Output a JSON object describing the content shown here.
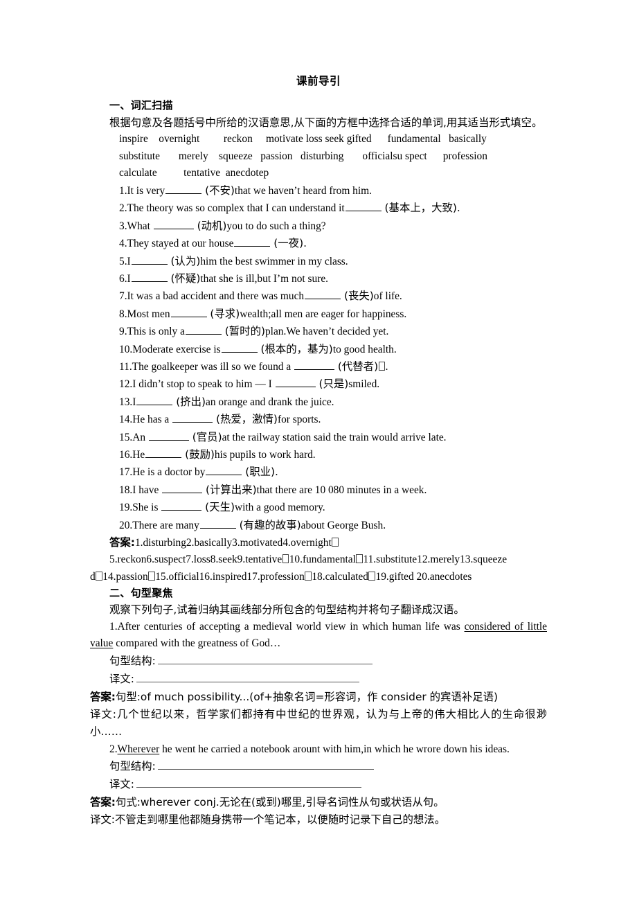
{
  "document": {
    "title": "课前导引"
  },
  "section1": {
    "heading": "一、词汇扫描",
    "instruction": "根据句意及各题括号中所给的汉语意思,从下面的方框中选择合适的单词,用其适当形式填空。",
    "word_bank_rows": [
      "inspire    overnight         reckon     motivate loss seek gifted      fundamental   basically",
      "substitute       merely    squeeze   passion   disturbing       officialsu spect      profession",
      "calculate          tentative  anecdotep"
    ],
    "word_bank_flat": [
      "inspire",
      "overnight",
      "reckon",
      "motivate",
      "loss",
      "seek",
      "gifted",
      "fundamental",
      "basically",
      "substitute",
      "merely",
      "squeeze",
      "passion",
      "disturbing",
      "officialsu spect",
      "profession",
      "calculate",
      "tentative",
      "anecdotep"
    ],
    "questions": [
      {
        "num": "1.",
        "pre": "It is very",
        "hint": "(不安)",
        "post": "that we haven’t heard from him.",
        "blank": "b-md",
        "gap_before": false
      },
      {
        "num": "2.",
        "pre": "The theory was so complex that I can understand it",
        "hint": "(基本上，大致).",
        "post": "",
        "blank": "b-md",
        "gap_before": false
      },
      {
        "num": "3.",
        "pre": "What",
        "hint": "(动机)",
        "post": "you to do such a thing?",
        "blank": "b-lg",
        "gap_before": true
      },
      {
        "num": "4.",
        "pre": "They stayed at our house",
        "hint": "(一夜).",
        "post": "",
        "blank": "b-md",
        "gap_before": false
      },
      {
        "num": "5.",
        "pre": "I",
        "hint": "(认为)",
        "post": "him the best swimmer in my class.",
        "blank": "b-md",
        "gap_before": false
      },
      {
        "num": "6.",
        "pre": "I",
        "hint": "(怀疑)",
        "post": "that she is ill,but I’m not sure.",
        "blank": "b-md",
        "gap_before": false
      },
      {
        "num": "7.",
        "pre": "It was a bad accident and there was much",
        "hint": "(丧失)",
        "post": "of life.",
        "blank": "b-md",
        "gap_before": false
      },
      {
        "num": "8.",
        "pre": "Most men",
        "hint": "(寻求)",
        "post": "wealth;all men are eager for happiness.",
        "blank": "b-md",
        "gap_before": false
      },
      {
        "num": "9.",
        "pre": "This is only a",
        "hint": "(暂时的)",
        "post": "plan.We haven’t decided yet.",
        "blank": "b-md",
        "gap_before": false
      },
      {
        "num": "10.",
        "pre": "Moderate exercise is",
        "hint": "(根本的，基为)",
        "post": "to good health.",
        "blank": "b-md",
        "gap_before": false
      },
      {
        "num": "11.",
        "pre": "The goalkeeper was ill so we found a",
        "hint": "(代替者)",
        "post": ".",
        "blank": "b-lg",
        "gap_before": true,
        "tofu_after_hint": true
      },
      {
        "num": "12.",
        "pre": "I didn’t stop to speak to him — I",
        "hint": "(只是)",
        "post": "smiled.",
        "blank": "b-lg",
        "gap_before": true
      },
      {
        "num": "13.",
        "pre": "I",
        "hint": "(挤出)",
        "post": "an orange and drank the juice.",
        "blank": "b-md",
        "gap_before": false
      },
      {
        "num": "14.",
        "pre": "He has a",
        "hint": "(热爱，激情)",
        "post": "for sports.",
        "blank": "b-lg",
        "gap_before": true
      },
      {
        "num": "15.",
        "pre": "An",
        "hint": "(官员)",
        "post": "at the railway station said the train would arrive late.",
        "blank": "b-lg",
        "gap_before": true
      },
      {
        "num": "16.",
        "pre": "He",
        "hint": "(鼓励)",
        "post": "his pupils to work hard.",
        "blank": "b-md",
        "gap_before": false
      },
      {
        "num": "17.",
        "pre": "He is a doctor by",
        "hint": "(职业).",
        "post": "",
        "blank": "b-md",
        "gap_before": false
      },
      {
        "num": "18.",
        "pre": "I have",
        "hint": "(计算出来)",
        "post": "that there are 10 080 minutes in a week.",
        "blank": "b-lg",
        "gap_before": true
      },
      {
        "num": "19.",
        "pre": "She is",
        "hint": "(天生)",
        "post": "with a good memory.",
        "blank": "b-lg",
        "gap_before": true
      },
      {
        "num": "20.",
        "pre": "There are many",
        "hint": "(有趣的故事)",
        "post": "about George Bush.",
        "blank": "b-md",
        "gap_before": false
      }
    ],
    "answer_label": "答案:",
    "answer_line_1": "1.disturbing2.basically3.motivated4.overnight",
    "answer_line_2": "5.reckon6.suspect7.loss8.seek9.tentative",
    "answer_line_2b": "10.fundamental",
    "answer_line_2c": "11.substitute12.merely13.squeeze",
    "answer_line_3a": "d",
    "answer_line_3b": "14.passion",
    "answer_line_3c": "15.official16.inspired17.profession",
    "answer_line_3d": "18.calculated",
    "answer_line_3e": "19.gifted    20.anecdotes"
  },
  "section2": {
    "heading": "二、句型聚焦",
    "instruction": "观察下列句子,试着归纳其画线部分所包含的句型结构并将句子翻译成汉语。",
    "items": [
      {
        "num": "1.",
        "sentence_a": "After centuries of accepting a medieval world view in which human life was ",
        "underline_a": "considered of little value",
        "sentence_b": " compared with the greatness of God…",
        "structure_label": "句型结构:",
        "translation_label": "译文:",
        "answer_label": "答案:",
        "answer_text": "句型:of much possibility...(of+抽象名词=形容词，作 consider 的宾语补足语)",
        "trans_label2": "译文:",
        "trans_text": "几个世纪以来，哲学家们都持有中世纪的世界观，认为与上帝的伟大相比人的生命很渺小……"
      },
      {
        "num": "2.",
        "underline_a": "Wherever",
        "sentence_b": " he went he carried a notebook arount with him,in which he wrore down his ideas.",
        "structure_label": "句型结构:",
        "translation_label": "译文:",
        "answer_label": "答案:",
        "answer_text": "句式:wherever conj.无论在(或到)哪里,引导名词性从句或状语从句。",
        "trans_label2": "译文:",
        "trans_text": "不管走到哪里他都随身携带一个笔记本，以便随时记录下自己的想法。"
      }
    ]
  }
}
